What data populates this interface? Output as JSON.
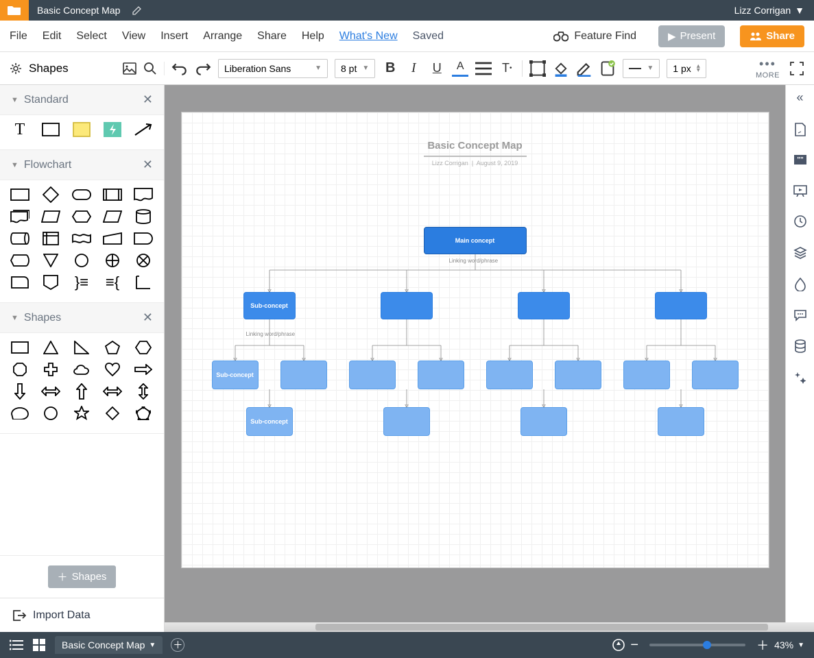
{
  "titlebar": {
    "doc_title": "Basic Concept Map",
    "user_name": "Lizz Corrigan"
  },
  "menubar": {
    "items": [
      "File",
      "Edit",
      "Select",
      "View",
      "Insert",
      "Arrange",
      "Share",
      "Help"
    ],
    "whats_new": "What's New",
    "saved": "Saved",
    "feature_find": "Feature Find",
    "present": "Present",
    "share": "Share"
  },
  "toolbar": {
    "shapes_label": "Shapes",
    "font": "Liberation Sans",
    "font_size": "8 pt",
    "line_size": "1 px",
    "more_label": "MORE"
  },
  "sidebar": {
    "sections": [
      {
        "title": "Standard"
      },
      {
        "title": "Flowchart"
      },
      {
        "title": "Shapes"
      }
    ],
    "add_shapes_btn": "Shapes",
    "import_data": "Import Data"
  },
  "canvas": {
    "title": "Basic Concept Map",
    "subtitle_author": "Lizz Corrigan",
    "subtitle_date": "August 9, 2019",
    "nodes": {
      "main": "Main concept",
      "link1": "Linking word/phrase",
      "sub1": "Sub-concept",
      "link2": "Linking word/phrase",
      "sub2": "Sub-concept",
      "sub3": "Sub-concept"
    }
  },
  "bottombar": {
    "tab": "Basic Concept Map",
    "zoom": "43%"
  }
}
